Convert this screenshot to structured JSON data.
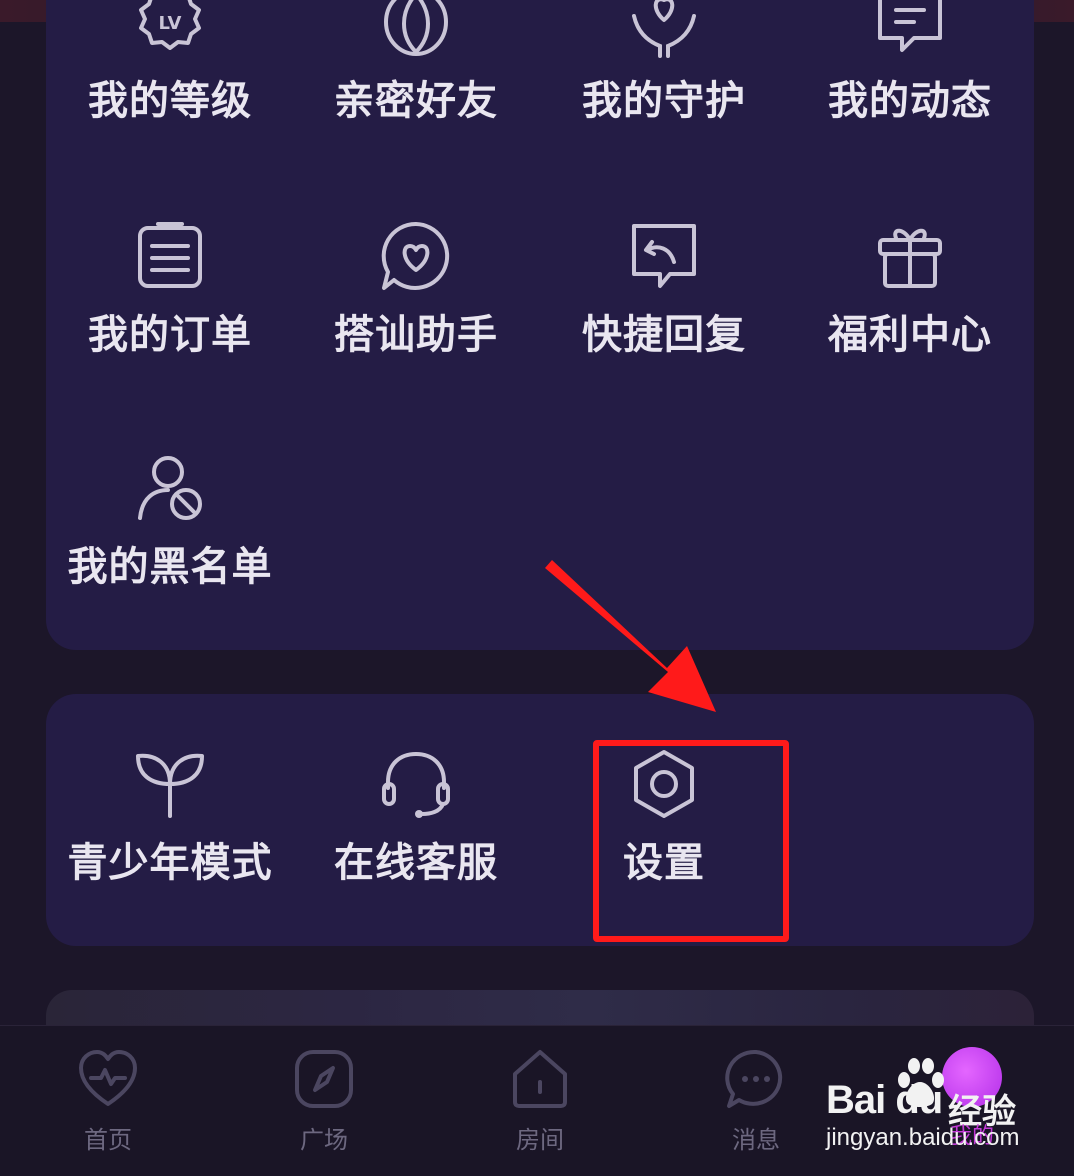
{
  "menu_main": {
    "items": [
      {
        "label": "我的等级",
        "icon": "level-badge-icon"
      },
      {
        "label": "亲密好友",
        "icon": "intimate-friends-icon"
      },
      {
        "label": "我的守护",
        "icon": "guardian-heart-icon"
      },
      {
        "label": "我的动态",
        "icon": "feed-note-icon"
      },
      {
        "label": "我的订单",
        "icon": "order-list-icon"
      },
      {
        "label": "搭讪助手",
        "icon": "chat-heart-icon"
      },
      {
        "label": "快捷回复",
        "icon": "quick-reply-icon"
      },
      {
        "label": "福利中心",
        "icon": "gift-icon"
      },
      {
        "label": "我的黑名单",
        "icon": "blocked-user-icon"
      }
    ]
  },
  "menu_secondary": {
    "items": [
      {
        "label": "青少年模式",
        "icon": "sprout-icon"
      },
      {
        "label": "在线客服",
        "icon": "headset-icon"
      },
      {
        "label": "设置",
        "icon": "settings-hexagon-icon"
      }
    ]
  },
  "bottom_nav": {
    "items": [
      {
        "label": "首页",
        "icon": "heart-pulse-icon"
      },
      {
        "label": "广场",
        "icon": "compass-icon"
      },
      {
        "label": "房间",
        "icon": "house-icon"
      },
      {
        "label": "消息",
        "icon": "message-bubble-icon"
      },
      {
        "label": "我的",
        "icon": "avatar"
      }
    ]
  },
  "watermark": {
    "brand": "Bai du",
    "text": "经验",
    "url": "jingyan.baidu.com"
  },
  "colors": {
    "background": "#1c1629",
    "panel": "#241c45",
    "label": "#e9e6f0",
    "icon": "#c9c4d6",
    "nav_inactive": "#6d6880",
    "annotation": "#ff1a1a",
    "active_avatar": "#c23bd6"
  }
}
